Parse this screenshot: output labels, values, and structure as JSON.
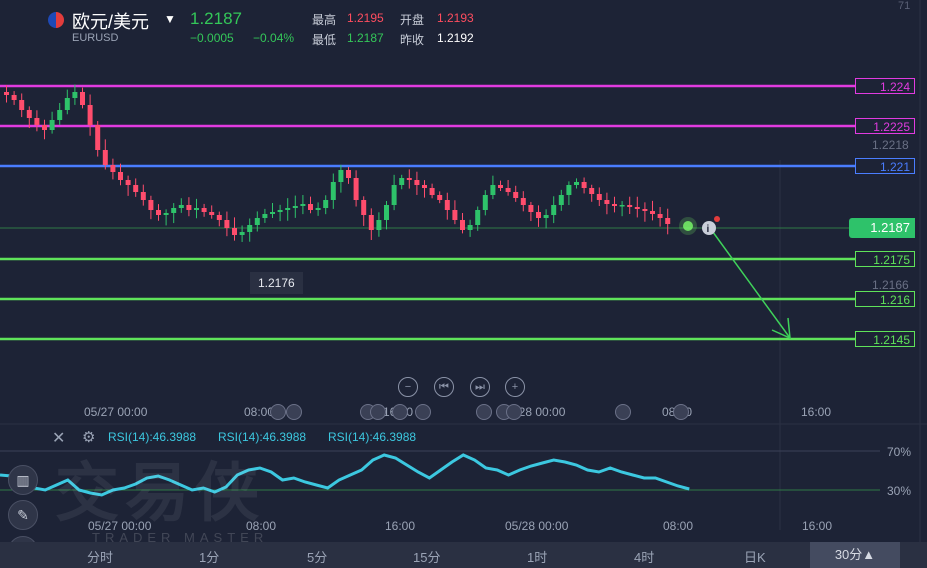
{
  "header": {
    "symbol_name": "欧元/美元",
    "symbol_code": "EURUSD",
    "last_price": "1.2187",
    "change": "−0.0005",
    "change_pct": "−0.04%",
    "high_label": "最高",
    "high_value": "1.2195",
    "open_label": "开盘",
    "open_value": "1.2193",
    "low_label": "最低",
    "low_value": "1.2187",
    "prev_close_label": "昨收",
    "prev_close_value": "1.2192"
  },
  "price_tags": {
    "line_1224": "1.224",
    "line_12225": "1.2225",
    "axis_12218": "1.2218",
    "line_1221": "1.221",
    "current": "1.2187",
    "line_12175": "1.2175",
    "axis_12166": "1.2166",
    "line_1216": "1.216",
    "line_12145": "1.2145",
    "low_marker": "1.2176",
    "top_partial": "71"
  },
  "colors": {
    "magenta_line": "#e13be0",
    "blue_line": "#4a7dff",
    "green_line": "#5fe35a",
    "up": "#2ec26a",
    "down": "#ff4d6d",
    "rsi": "#3cc8e0"
  },
  "main_xaxis": [
    "05/27 00:00",
    "08:00",
    "16:00",
    "05/28 00:00",
    "08:00",
    "16:00"
  ],
  "rsi": {
    "labels": [
      "RSI(14):46.3988",
      "RSI(14):46.3988",
      "RSI(14):46.3988"
    ],
    "level_70": "70%",
    "level_30": "30%",
    "xaxis": [
      "05/27 00:00",
      "08:00",
      "16:00",
      "05/28 00:00",
      "08:00",
      "16:00"
    ]
  },
  "timeframes": [
    "分时",
    "1分",
    "5分",
    "15分",
    "1时",
    "4时",
    "日K",
    "30分▲"
  ],
  "watermark": {
    "cn": "交易侠",
    "en": "TRADER MASTER"
  },
  "icons": [
    "minus-icon",
    "rewind-icon",
    "forward-icon",
    "plus-icon",
    "close-icon",
    "settings-icon",
    "info-icon",
    "pencil-icon",
    "indicator-icon"
  ]
}
